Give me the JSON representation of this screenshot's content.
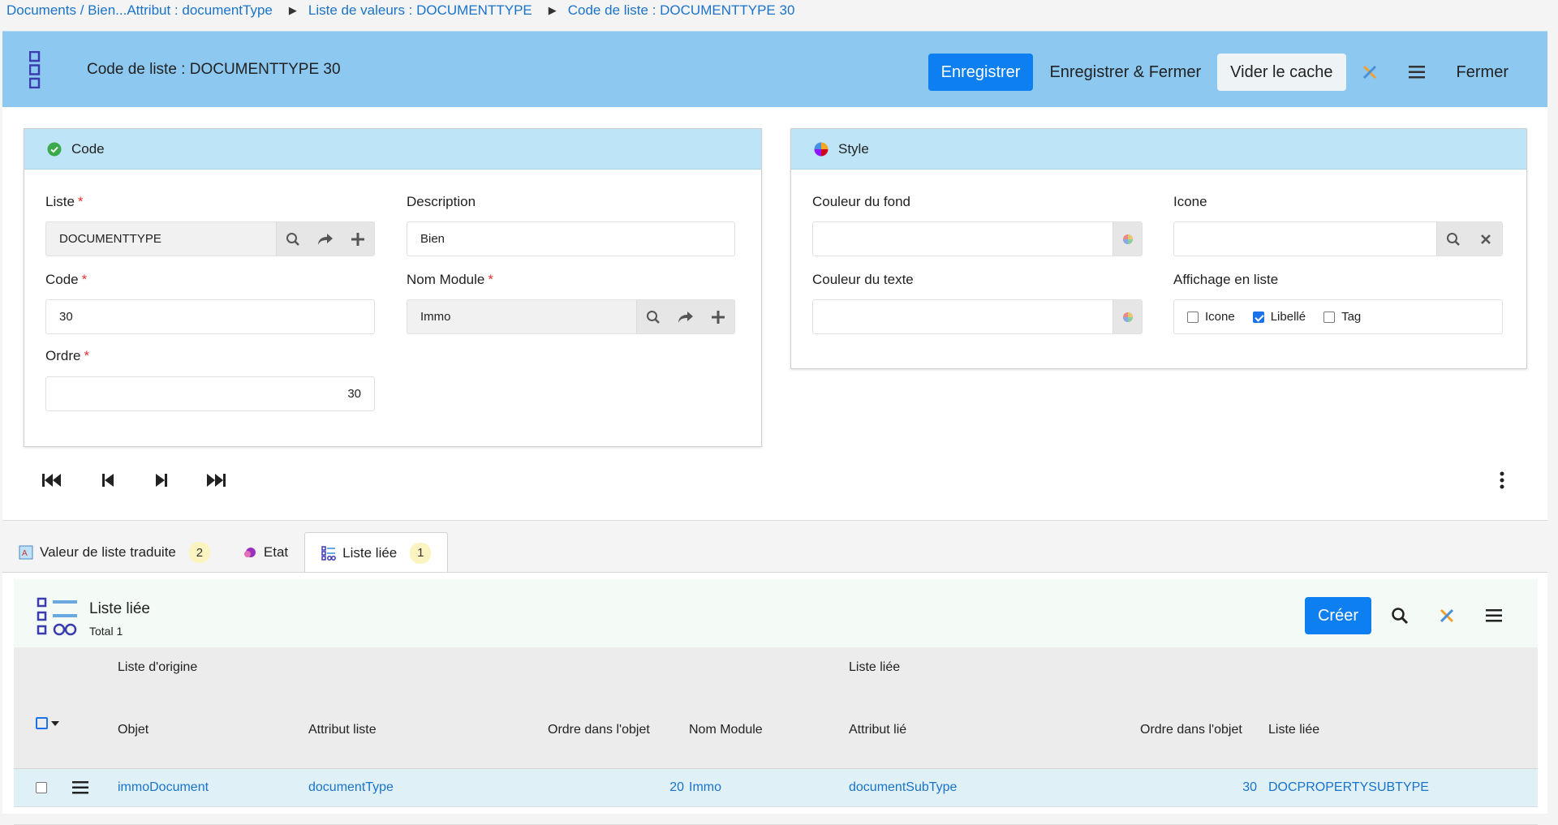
{
  "breadcrumb": {
    "items": [
      "Documents / Bien...Attribut : documentType",
      "Liste de valeurs : DOCUMENTTYPE",
      "Code de liste : DOCUMENTTYPE 30"
    ],
    "separator": "▶"
  },
  "header": {
    "title": "Code de liste : DOCUMENTTYPE 30",
    "save_label": "Enregistrer",
    "save_close_label": "Enregistrer & Fermer",
    "clear_cache_label": "Vider le cache",
    "close_label": "Fermer"
  },
  "code_panel": {
    "title": "Code",
    "liste_label": "Liste",
    "liste_value": "DOCUMENTTYPE",
    "description_label": "Description",
    "description_value": "Bien",
    "code_label": "Code",
    "code_value": "30",
    "module_label": "Nom Module",
    "module_value": "Immo",
    "ordre_label": "Ordre",
    "ordre_value": "30",
    "required_mark": "*"
  },
  "style_panel": {
    "title": "Style",
    "bg_color_label": "Couleur du fond",
    "text_color_label": "Couleur du texte",
    "icon_label": "Icone",
    "display_label": "Affichage en liste",
    "display_options": [
      {
        "label": "Icone",
        "checked": false
      },
      {
        "label": "Libellé",
        "checked": true
      },
      {
        "label": "Tag",
        "checked": false
      }
    ]
  },
  "tabs": [
    {
      "label": "Valeur de liste traduite",
      "count": "2"
    },
    {
      "label": "Etat",
      "count": ""
    },
    {
      "label": "Liste liée",
      "count": "1"
    }
  ],
  "subgrid": {
    "title": "Liste liée",
    "total": "Total 1",
    "create_label": "Créer",
    "group_headers": [
      "Liste d'origine",
      "Liste liée"
    ],
    "columns": [
      "Objet",
      "Attribut liste",
      "Ordre dans l'objet",
      "Nom Module",
      "Attribut lié",
      "Ordre dans l'objet",
      "Liste liée"
    ],
    "rows": [
      {
        "objet": "immoDocument",
        "attribut": "documentType",
        "ordre": "20",
        "module": "Immo",
        "attribut_lie": "documentSubType",
        "ordre_lie": "30",
        "liste_liee": "DOCPROPERTYSUBTYPE"
      }
    ]
  },
  "colors": {
    "header_bg": "#8cc8ef",
    "panel_head_bg": "#bde5f7",
    "primary": "#0d7ff0",
    "link": "#1a73c9"
  }
}
